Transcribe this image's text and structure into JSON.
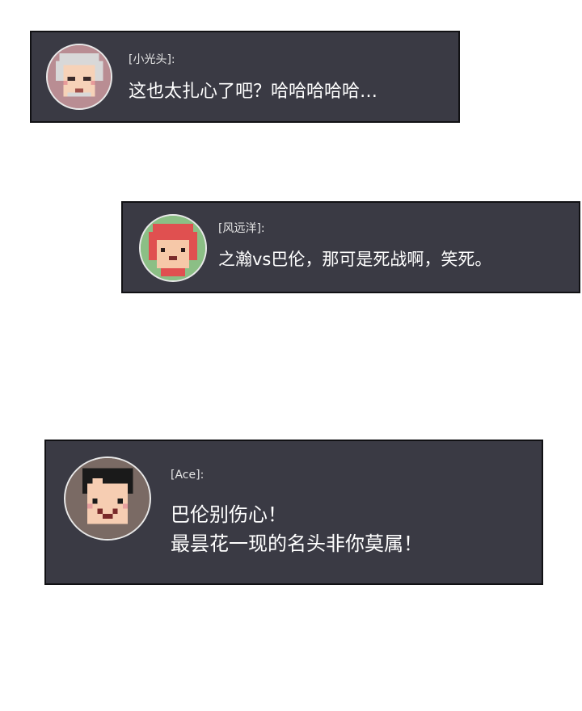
{
  "messages": [
    {
      "speaker": "[小光头]:",
      "avatar_icon": "bald-elder-avatar-icon",
      "avatar_bg": "#b98d93",
      "lines": [
        "这也太扎心了吧？哈哈哈哈哈…"
      ]
    },
    {
      "speaker": "[风远洋]:",
      "avatar_icon": "red-hair-avatar-icon",
      "avatar_bg": "#8bbf85",
      "lines": [
        "之瀚vs巴伦，那可是死战啊，笑死。"
      ]
    },
    {
      "speaker": "[Ace]:",
      "avatar_icon": "black-hair-avatar-icon",
      "avatar_bg": "#7a6a64",
      "lines": [
        "巴伦别伤心！",
        "最昙花一现的名头非你莫属！"
      ]
    }
  ],
  "colors": {
    "bubble_bg": "#3a3a44",
    "bubble_border": "#111114",
    "page_bg": "#ffffff",
    "text": "#ffffff"
  }
}
